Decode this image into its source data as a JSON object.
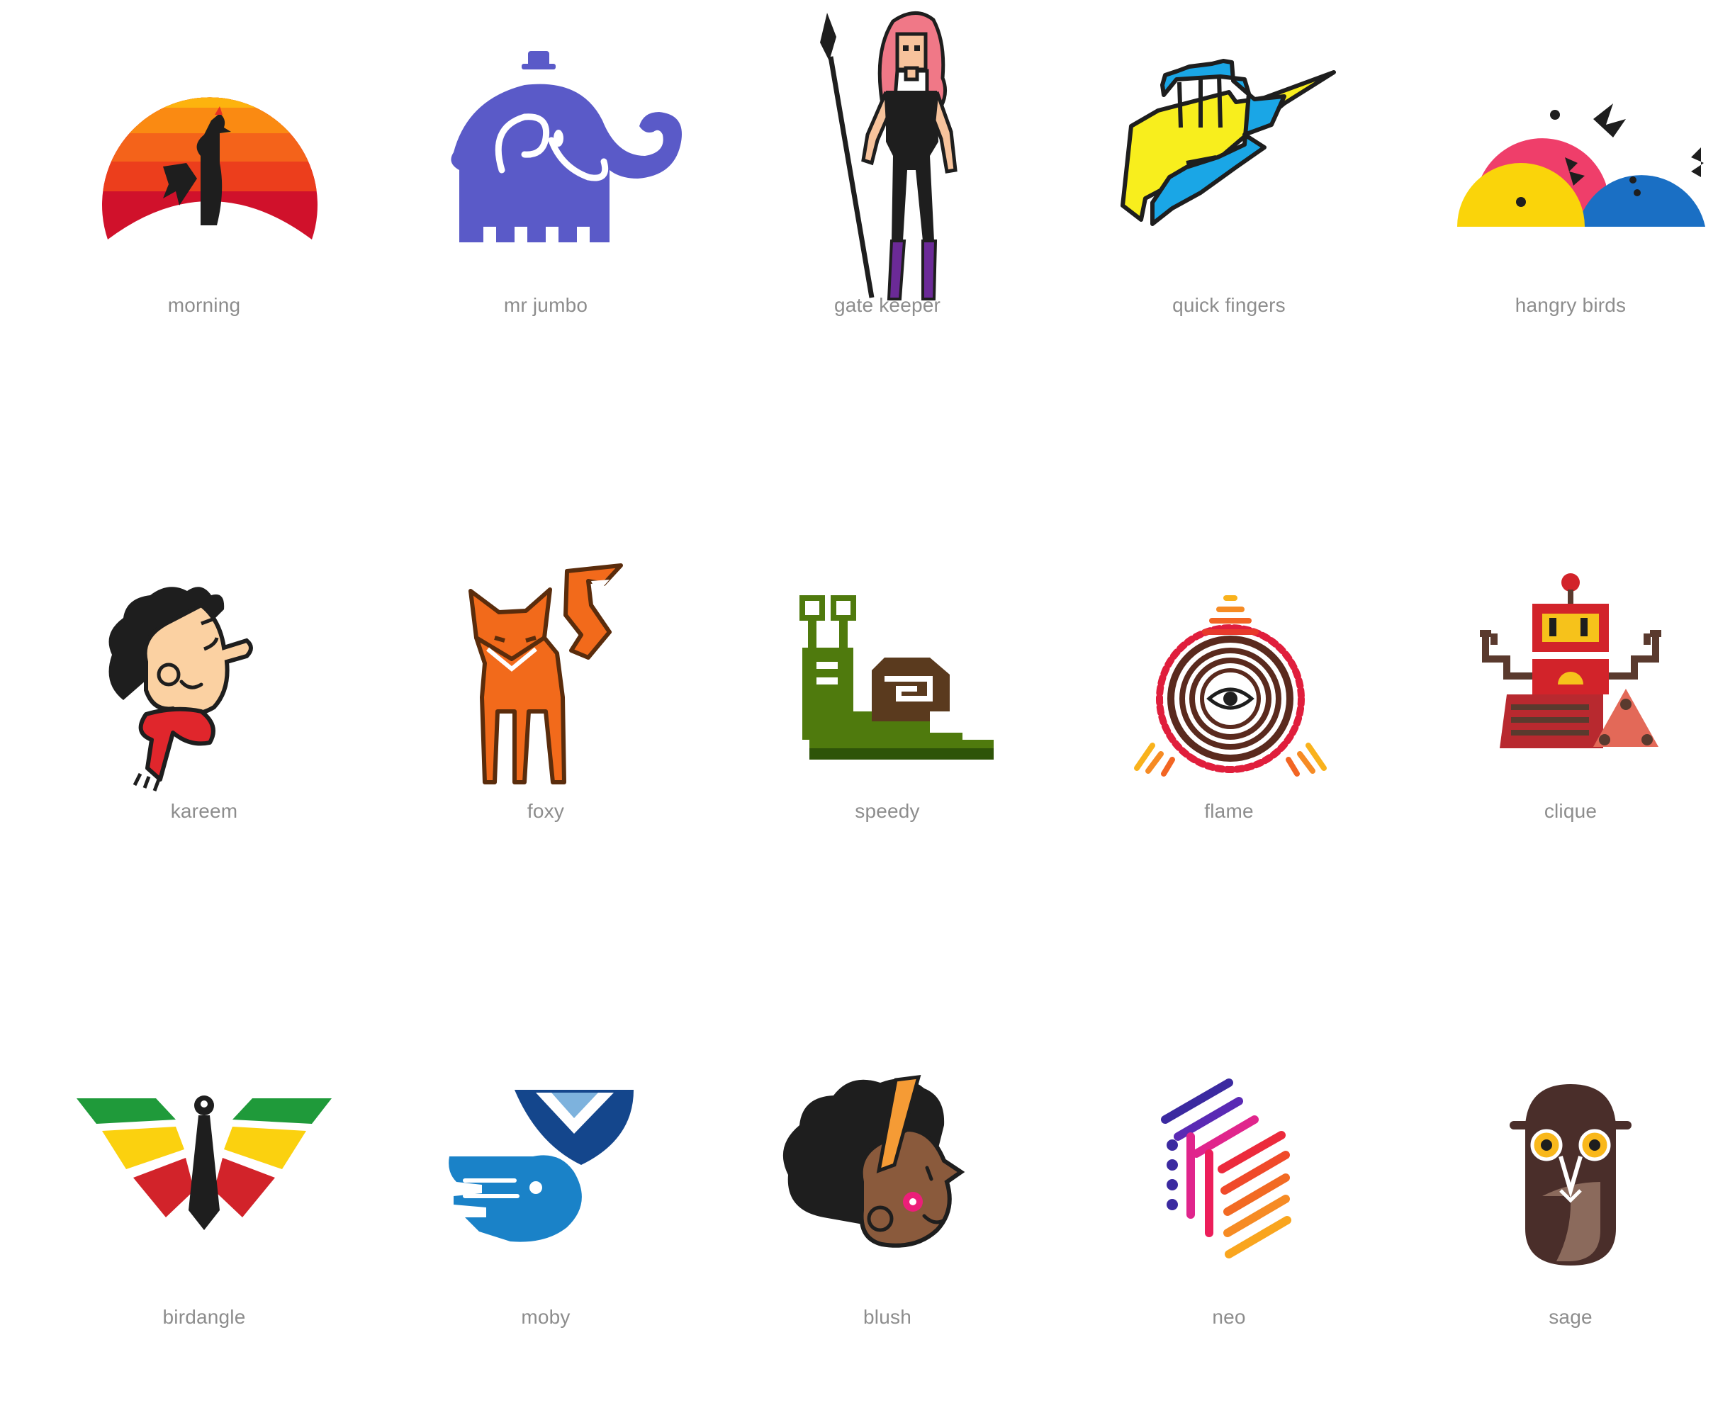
{
  "gallery": {
    "items": [
      {
        "label": "morning"
      },
      {
        "label": "mr jumbo"
      },
      {
        "label": "gate keeper"
      },
      {
        "label": "quick fingers"
      },
      {
        "label": "hangry birds"
      },
      {
        "label": "kareem"
      },
      {
        "label": "foxy"
      },
      {
        "label": "speedy"
      },
      {
        "label": "flame"
      },
      {
        "label": "clique"
      },
      {
        "label": "birdangle"
      },
      {
        "label": "moby"
      },
      {
        "label": "blush"
      },
      {
        "label": "neo"
      },
      {
        "label": "sage"
      }
    ]
  },
  "icons": {
    "morning": "rooster-sunrise-icon",
    "mr_jumbo": "elephant-icon",
    "gate_keeper": "warrior-woman-icon",
    "quick_fingers": "fist-lightning-icon",
    "hangry_birds": "three-birds-icon",
    "kareem": "boy-scarf-icon",
    "foxy": "fox-icon",
    "speedy": "snail-icon",
    "flame": "eye-triangle-icon",
    "clique": "robot-icon",
    "birdangle": "bird-tie-icon",
    "moby": "whale-icon",
    "blush": "girl-profile-icon",
    "neo": "hexagon-lines-icon",
    "sage": "owl-icon"
  },
  "colors": {
    "label_text": "#8d8d8d",
    "background": "#ffffff"
  }
}
